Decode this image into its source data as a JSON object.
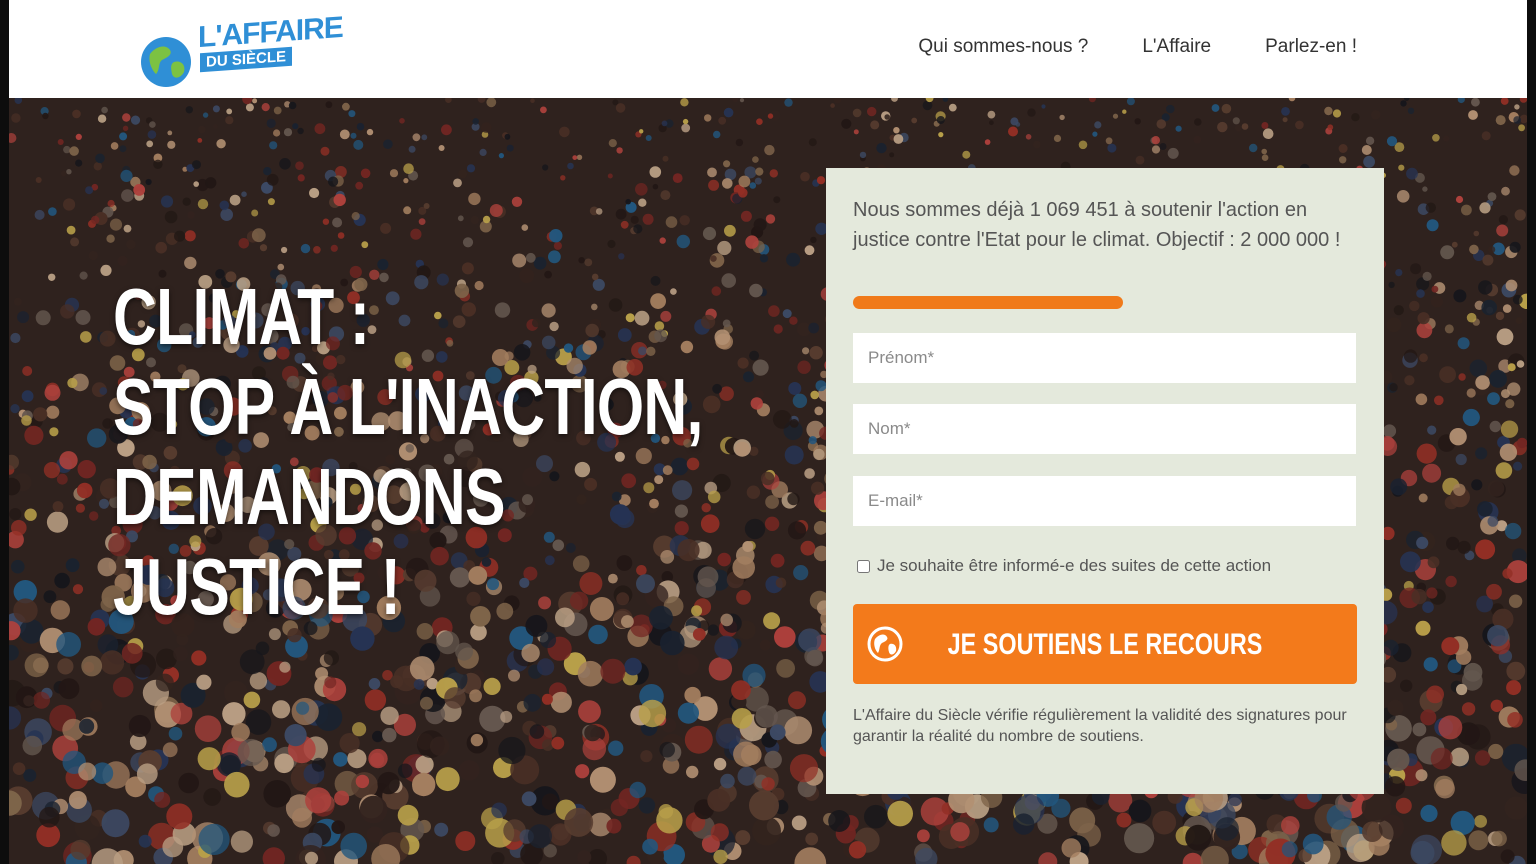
{
  "header": {
    "logo": {
      "line1": "L'AFFAIRE",
      "line2": "DU SIÈCLE"
    },
    "nav": [
      {
        "label": "Qui sommes-nous ?"
      },
      {
        "label": "L'Affaire"
      },
      {
        "label": "Parlez-en !"
      }
    ]
  },
  "hero": {
    "headline": [
      "CLIMAT :",
      "STOP À L'INACTION,",
      "DEMANDONS",
      "JUSTICE !"
    ]
  },
  "form": {
    "counter_text": "Nous sommes déjà 1 069 451 à soutenir l'action en justice contre l'Etat pour le climat. Objectif : 2 000 000 !",
    "progress": {
      "current": 1069451,
      "goal": 2000000,
      "fraction": 0.535
    },
    "fields": [
      {
        "placeholder": "Prénom*"
      },
      {
        "placeholder": "Nom*"
      },
      {
        "placeholder": "E-mail*"
      }
    ],
    "checkbox_label": "Je souhaite être informé-e des suites de cette action",
    "submit_label": "JE SOUTIENS LE RECOURS",
    "disclaimer": "L'Affaire du Siècle vérifie régulièrement la validité des signatures pour garantir la réalité du nombre de soutiens."
  },
  "colors": {
    "accent_orange": "#f37a1b",
    "logo_blue": "#2f8fd6",
    "panel_bg": "#e4e9dc",
    "header_bg": "#ffffff"
  },
  "icons": {
    "logo": "globe-icon",
    "submit": "globe-icon"
  }
}
